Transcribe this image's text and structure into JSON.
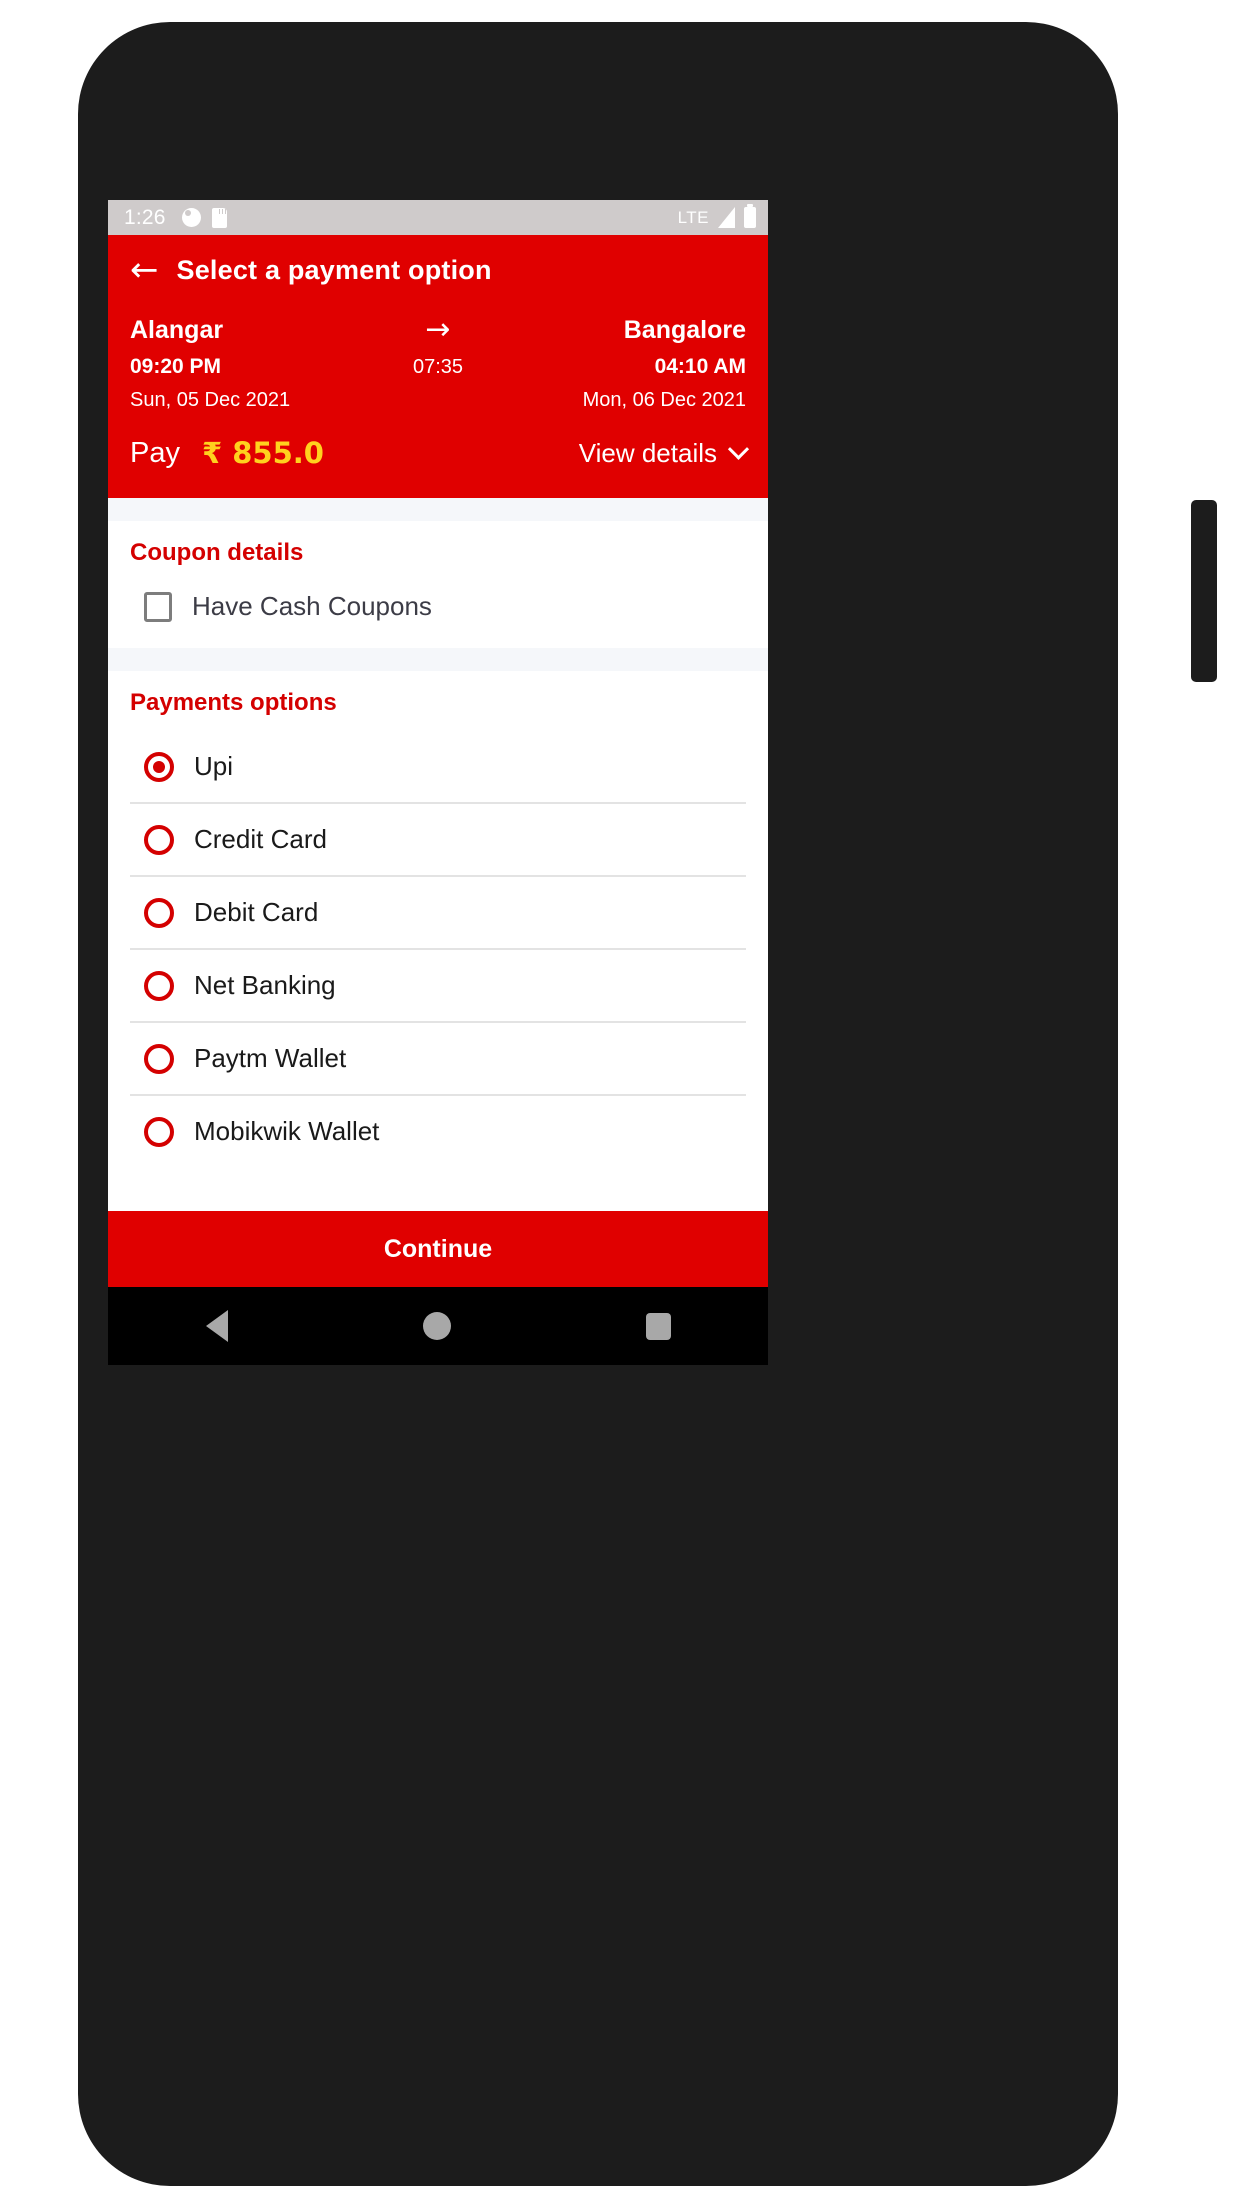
{
  "status_bar": {
    "time": "1:26",
    "network": "LTE",
    "icons": [
      "alarm-icon",
      "sd-card-icon",
      "signal-icon",
      "battery-icon"
    ]
  },
  "app_bar": {
    "back_icon": "back-arrow-icon",
    "title": "Select a payment option"
  },
  "journey": {
    "origin": "Alangar",
    "destination": "Bangalore",
    "arrow_icon": "arrow-right-icon",
    "departure_time": "09:20 PM",
    "duration": "07:35",
    "arrival_time": "04:10 AM",
    "departure_date": "Sun, 05 Dec 2021",
    "arrival_date": "Mon, 06 Dec 2021"
  },
  "pay_row": {
    "pay_label": "Pay",
    "amount": "₹ 855.0",
    "view_details_label": "View details",
    "chevron_icon": "chevron-down-icon"
  },
  "coupon_section": {
    "title": "Coupon details",
    "checkbox_label": "Have Cash Coupons",
    "checked": false
  },
  "payments_section": {
    "title": "Payments options",
    "options": [
      {
        "label": "Upi",
        "selected": true
      },
      {
        "label": "Credit Card",
        "selected": false
      },
      {
        "label": "Debit Card",
        "selected": false
      },
      {
        "label": "Net Banking",
        "selected": false
      },
      {
        "label": "Paytm Wallet",
        "selected": false
      },
      {
        "label": "Mobikwik Wallet",
        "selected": false
      }
    ]
  },
  "continue_button": {
    "label": "Continue"
  },
  "nav_bar": {
    "back_icon": "nav-back-icon",
    "home_icon": "nav-home-icon",
    "recents_icon": "nav-recents-icon"
  },
  "colors": {
    "brand_red": "#e00000",
    "accent_yellow": "#ffd21e",
    "section_title_red": "#d40000",
    "status_bar_bg": "#cfcbcb",
    "band_bg": "#f5f7fa"
  }
}
